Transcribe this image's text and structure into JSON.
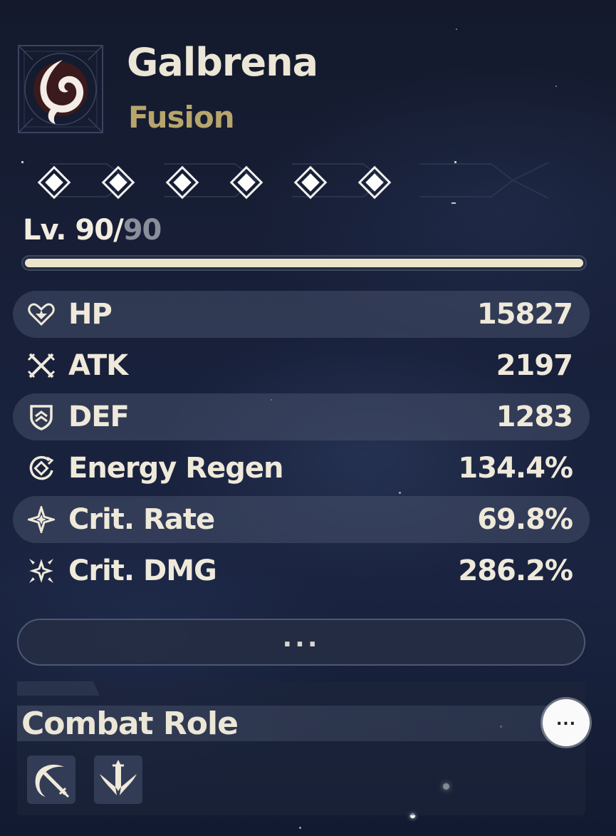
{
  "character": {
    "name": "Galbrena",
    "element": "Fusion",
    "element_icon": "fusion-flame-icon",
    "sequence_nodes": 6,
    "level_current": "90",
    "level_sep": "/",
    "level_max": "90",
    "level_prefix": "Lv. ",
    "xp_progress": 1.0
  },
  "stats": [
    {
      "label": "HP",
      "value": "15827",
      "icon": "hp-heart-icon"
    },
    {
      "label": "ATK",
      "value": "2197",
      "icon": "atk-crossed-swords-icon"
    },
    {
      "label": "DEF",
      "value": "1283",
      "icon": "def-shield-icon"
    },
    {
      "label": "Energy Regen",
      "value": "134.4%",
      "icon": "energy-regen-icon"
    },
    {
      "label": "Crit. Rate",
      "value": "69.8%",
      "icon": "crit-rate-star-icon"
    },
    {
      "label": "Crit. DMG",
      "value": "286.2%",
      "icon": "crit-dmg-burst-icon"
    }
  ],
  "more_button_label": "...",
  "combat_role": {
    "title": "Combat Role",
    "more_label": "...",
    "roles": [
      {
        "icon": "crescent-blade-role-icon"
      },
      {
        "icon": "sword-wings-role-icon"
      }
    ]
  },
  "colors": {
    "text": "#ece6d6",
    "element": "#b7a56c",
    "level_max": "#8a8f9b",
    "xp_fill": "#ece5cc"
  }
}
